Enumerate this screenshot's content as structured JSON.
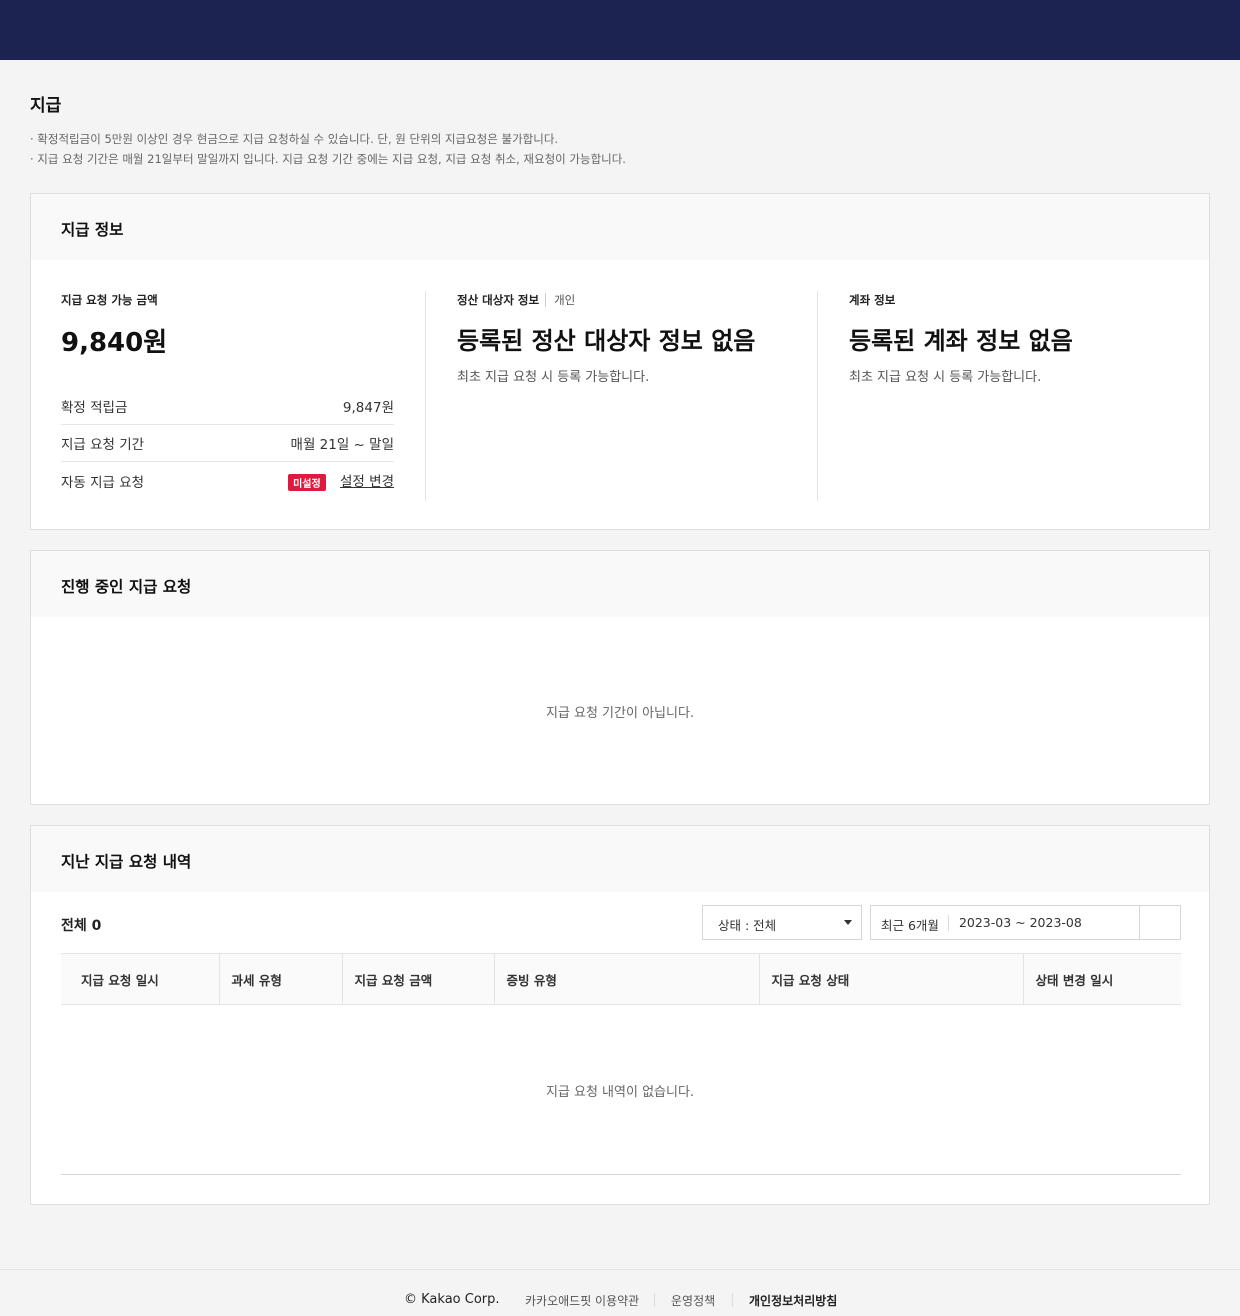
{
  "page": {
    "title": "지급",
    "notices": [
      "· 확정적립금이 5만원 이상인 경우 현금으로 지급 요청하실 수 있습니다. 단, 원 단위의 지급요청은 불가합니다.",
      "· 지급 요청 기간은 매월 21일부터 말일까지 입니다. 지급 요청 기간 중에는 지급 요청, 지급 요청 취소, 재요청이 가능합니다."
    ]
  },
  "payment_info": {
    "title": "지급 정보",
    "available_label": "지급 요청 가능 금액",
    "available_amount": "9,840원",
    "rows": [
      {
        "label": "확정 적립금",
        "value": "9,847원"
      },
      {
        "label": "지급 요청 기간",
        "value": "매월 21일 ~ 말일"
      },
      {
        "label": "자동 지급 요청",
        "badge": "미설정",
        "link": "설정 변경"
      }
    ],
    "settlement": {
      "label": "정산 대상자 정보",
      "type": "개인",
      "headline": "등록된 정산 대상자 정보 없음",
      "desc": "최초 지급 요청 시 등록 가능합니다."
    },
    "account": {
      "label": "계좌 정보",
      "headline": "등록된 계좌 정보 없음",
      "desc": "최초 지급 요청 시 등록 가능합니다."
    }
  },
  "in_progress": {
    "title": "진행 중인 지급 요청",
    "empty": "지급 요청 기간이 아닙니다."
  },
  "history": {
    "title": "지난 지급 요청 내역",
    "total": "전체 0",
    "status_select": "상태 : 전체",
    "period": "최근 6개월",
    "range": "2023-03 ~ 2023-08",
    "columns": [
      "지급 요청 일시",
      "과세 유형",
      "지급 요청 금액",
      "증빙 유형",
      "지급 요청 상태",
      "상태 변경 일시"
    ],
    "empty": "지급 요청 내역이 없습니다."
  },
  "footer": {
    "copyright": "© Kakao Corp.",
    "links": [
      "카카오애드핏 이용약관",
      "운영정책",
      "개인정보처리방침"
    ]
  }
}
